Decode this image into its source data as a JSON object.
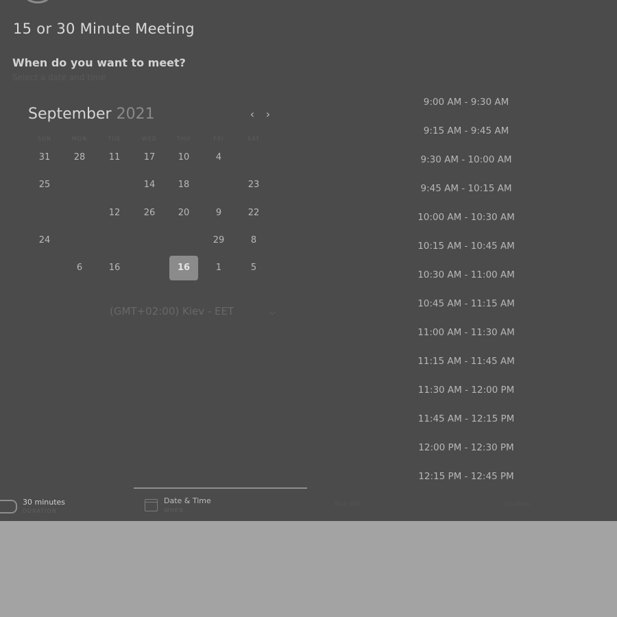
{
  "header": {
    "title": "15 or 30 Minute Meeting",
    "question": "When do you want to meet?",
    "subtitle": "Select a date and time"
  },
  "calendar": {
    "month": "September",
    "year": "2021",
    "prev_icon": "chevron-left-icon",
    "next_icon": "chevron-right-icon",
    "days_of_week": [
      "SUN",
      "MON",
      "TUE",
      "WED",
      "THU",
      "FRI",
      "SAT"
    ],
    "rows": [
      [
        "31",
        "28",
        "11",
        "17",
        "10",
        "4",
        ""
      ],
      [
        "25",
        "",
        "",
        "14",
        "18",
        "",
        "23"
      ],
      [
        "",
        "",
        "12",
        "26",
        "20",
        "9",
        "22"
      ],
      [
        "24",
        "",
        "",
        "",
        "",
        "29",
        "8"
      ],
      [
        "",
        "6",
        "16",
        "",
        "16",
        "1",
        "5"
      ]
    ],
    "selected_day": "16"
  },
  "timezone": {
    "label": "(GMT+02:00) Kiev - EET",
    "icon": "chevron-down-icon"
  },
  "time_slots": [
    "9:00 AM - 9:30 AM",
    "9:15 AM - 9:45 AM",
    "9:30 AM - 10:00 AM",
    "9:45 AM - 10:15 AM",
    "10:00 AM - 10:30 AM",
    "10:15 AM - 10:45 AM",
    "10:30 AM - 11:00 AM",
    "10:45 AM - 11:15 AM",
    "11:00 AM - 11:30 AM",
    "11:15 AM - 11:45 AM",
    "11:30 AM - 12:00 PM",
    "11:45 AM - 12:15 PM",
    "12:00 PM - 12:30 PM",
    "12:15 PM - 12:45 PM"
  ],
  "steps": {
    "step1": {
      "label": "30 minutes",
      "sub": "DURATION"
    },
    "step2": {
      "label": "Date & Time",
      "sub": "WHEN"
    },
    "step3": {
      "label": "Your info"
    },
    "step4": {
      "label": "Confirm"
    }
  }
}
